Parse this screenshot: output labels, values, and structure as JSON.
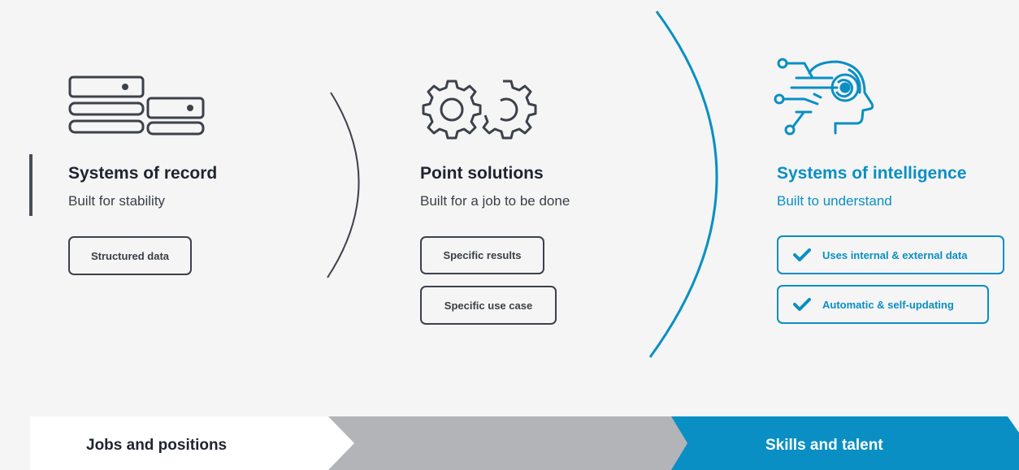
{
  "columns": [
    {
      "title": "Systems of record",
      "subtitle": "Built for stability",
      "icon": "server-stack-icon",
      "tags": [
        "Structured data"
      ]
    },
    {
      "title": "Point solutions",
      "subtitle": "Built for a job to be done",
      "icon": "gears-icon",
      "tags": [
        "Specific results",
        "Specific use case"
      ]
    },
    {
      "title": "Systems of intelligence",
      "subtitle": "Built to understand",
      "icon": "ai-head-icon",
      "tags": [
        "Uses internal & external data",
        "Automatic & self-updating"
      ],
      "tag_icon": "checkmark-icon"
    }
  ],
  "stages": {
    "left": "Jobs and positions",
    "middle": "",
    "right": "Skills and talent"
  },
  "colors": {
    "accent": "#0a8fc4",
    "dark": "#3d414a",
    "background": "#f5f5f5",
    "gray_band": "#b3b4b8"
  }
}
